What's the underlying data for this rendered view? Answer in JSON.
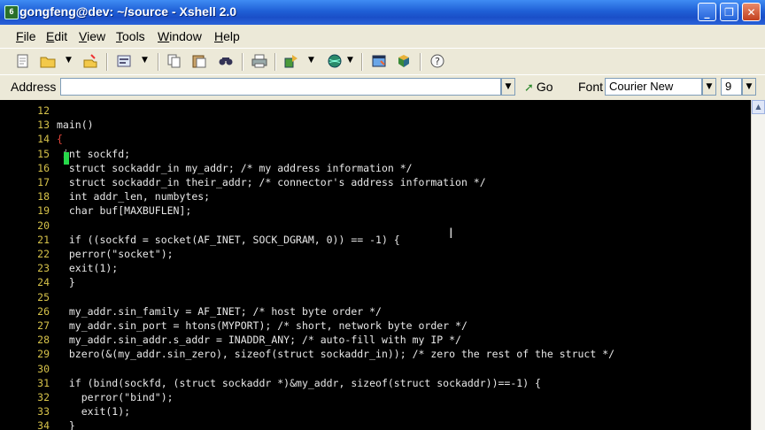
{
  "window": {
    "title": "gongfeng@dev: ~/source - Xshell 2.0",
    "app_icon": "6",
    "minimize": "_",
    "restore": "❐",
    "close": "✕"
  },
  "menu": [
    {
      "first": "F",
      "rest": "ile"
    },
    {
      "first": "E",
      "rest": "dit"
    },
    {
      "first": "V",
      "rest": "iew"
    },
    {
      "first": "T",
      "rest": "ools"
    },
    {
      "first": "W",
      "rest": "indow"
    },
    {
      "first": "H",
      "rest": "elp"
    }
  ],
  "toolbar": {
    "icons": [
      "new-session-icon",
      "open-folder-icon",
      "reconnect-icon",
      "properties-icon",
      "copy-icon",
      "paste-icon",
      "find-icon",
      "print-icon",
      "transfer-icon",
      "globe-icon",
      "new-window-icon",
      "script-icon",
      "help-icon"
    ]
  },
  "address": {
    "label": "Address",
    "value": "",
    "go_label": "Go",
    "go_icon": "➚"
  },
  "font": {
    "label": "Font",
    "family": "Courier New",
    "size": "9"
  },
  "dropdown_arrow": "▼",
  "terminal": {
    "lines": [
      {
        "n": "12",
        "t": ""
      },
      {
        "n": "13",
        "t": "main()"
      },
      {
        "n": "14",
        "t": "{"
      },
      {
        "n": "15",
        "t": " int sockfd;"
      },
      {
        "n": "16",
        "t": "  struct sockaddr_in my_addr; /* my address information */"
      },
      {
        "n": "17",
        "t": "  struct sockaddr_in their_addr; /* connector's address information */"
      },
      {
        "n": "18",
        "t": "  int addr_len, numbytes;"
      },
      {
        "n": "19",
        "t": "  char buf[MAXBUFLEN];"
      },
      {
        "n": "20",
        "t": ""
      },
      {
        "n": "21",
        "t": "  if ((sockfd = socket(AF_INET, SOCK_DGRAM, 0)) == -1) {"
      },
      {
        "n": "22",
        "t": "  perror(\"socket\");"
      },
      {
        "n": "23",
        "t": "  exit(1);"
      },
      {
        "n": "24",
        "t": "  }"
      },
      {
        "n": "25",
        "t": ""
      },
      {
        "n": "26",
        "t": "  my_addr.sin_family = AF_INET; /* host byte order */"
      },
      {
        "n": "27",
        "t": "  my_addr.sin_port = htons(MYPORT); /* short, network byte order */"
      },
      {
        "n": "28",
        "t": "  my_addr.sin_addr.s_addr = INADDR_ANY; /* auto-fill with my IP */"
      },
      {
        "n": "29",
        "t": "  bzero(&(my_addr.sin_zero), sizeof(struct sockaddr_in)); /* zero the rest of the struct */"
      },
      {
        "n": "30",
        "t": ""
      },
      {
        "n": "31",
        "t": "  if (bind(sockfd, (struct sockaddr *)&my_addr, sizeof(struct sockaddr))==-1) {"
      },
      {
        "n": "32",
        "t": "    perror(\"bind\");"
      },
      {
        "n": "33",
        "t": "    exit(1);"
      },
      {
        "n": "34",
        "t": "  }"
      }
    ]
  }
}
